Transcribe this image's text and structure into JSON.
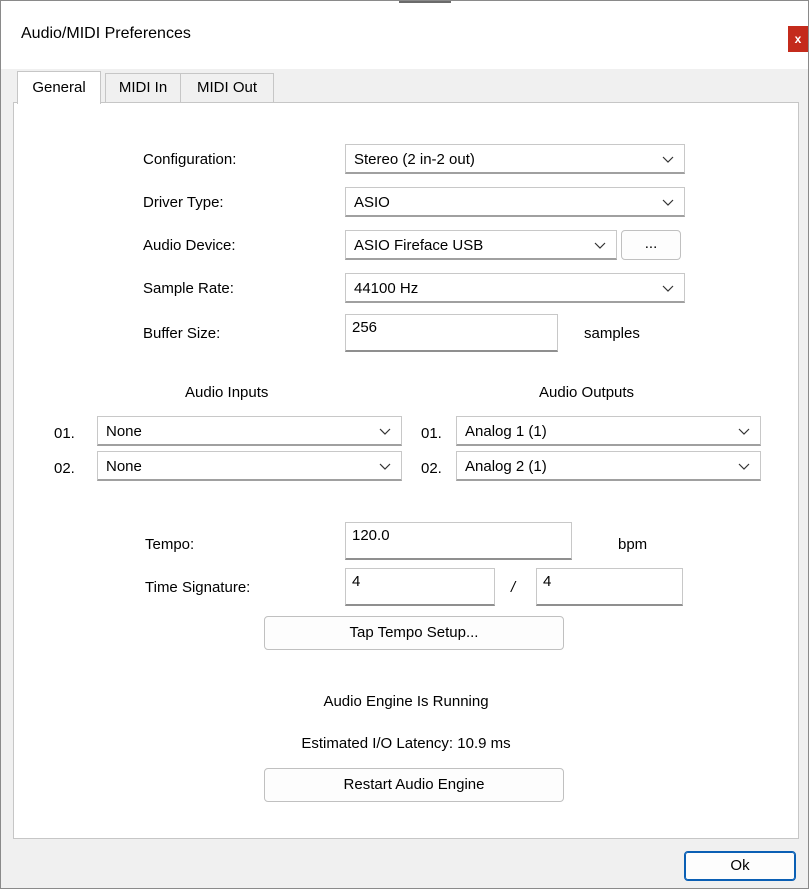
{
  "window": {
    "title": "Audio/MIDI Preferences",
    "close_label": "x"
  },
  "tabs": [
    {
      "label": "General",
      "active": true
    },
    {
      "label": "MIDI In",
      "active": false
    },
    {
      "label": "MIDI Out",
      "active": false
    }
  ],
  "general": {
    "configuration": {
      "label": "Configuration:",
      "value": "Stereo (2 in-2 out)"
    },
    "driver_type": {
      "label": "Driver Type:",
      "value": "ASIO"
    },
    "audio_device": {
      "label": "Audio Device:",
      "value": "ASIO Fireface USB",
      "more_button": "..."
    },
    "sample_rate": {
      "label": "Sample Rate:",
      "value": "44100 Hz"
    },
    "buffer_size": {
      "label": "Buffer Size:",
      "value": "256",
      "unit": "samples"
    }
  },
  "audio_inputs": {
    "header": "Audio Inputs",
    "rows": [
      {
        "index": "01.",
        "value": "None"
      },
      {
        "index": "02.",
        "value": "None"
      }
    ]
  },
  "audio_outputs": {
    "header": "Audio Outputs",
    "rows": [
      {
        "index": "01.",
        "value": "Analog 1 (1)"
      },
      {
        "index": "02.",
        "value": "Analog 2 (1)"
      }
    ]
  },
  "tempo": {
    "label": "Tempo:",
    "value": "120.0",
    "unit": "bpm"
  },
  "time_signature": {
    "label": "Time Signature:",
    "numerator": "4",
    "separator": "/",
    "denominator": "4"
  },
  "tap_tempo_button": "Tap Tempo Setup...",
  "status": {
    "engine": "Audio Engine Is Running",
    "latency": "Estimated I/O Latency: 10.9 ms"
  },
  "restart_button": "Restart Audio Engine",
  "ok_button": "Ok"
}
